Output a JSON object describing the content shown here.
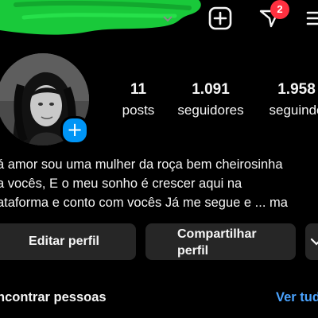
{
  "header": {
    "notification_count": "2",
    "icons": {
      "create": "plus-square-icon",
      "activity": "heart-icon",
      "menu": "hamburger-menu-icon",
      "account_switch": "chevron-down-icon"
    },
    "scribble_color": "#19c93a"
  },
  "profile": {
    "stats": [
      {
        "value": "11",
        "label": "posts"
      },
      {
        "value": "1.091",
        "label": "seguidores"
      },
      {
        "value": "1.958",
        "label": "seguindo"
      }
    ],
    "bio_lines": [
      "á amor sou uma mulher da roça bem cheirosinha",
      "a vocês, E o meu sonho é crescer aqui na",
      "ataforma e conto com vocês Já me segue e ... ma"
    ],
    "add_story_symbol": "+"
  },
  "actions": {
    "edit_label": "Editar perfil",
    "share_label": "Compartilhar perfil",
    "more_icon": "chevron-down-icon"
  },
  "discover": {
    "title": "ncontrar pessoas",
    "see_all": "Ver tud"
  },
  "colors": {
    "background": "#000000",
    "accent": "#0095f6",
    "badge": "#ff3040",
    "button": "#262626",
    "link": "#4aa3ff"
  }
}
